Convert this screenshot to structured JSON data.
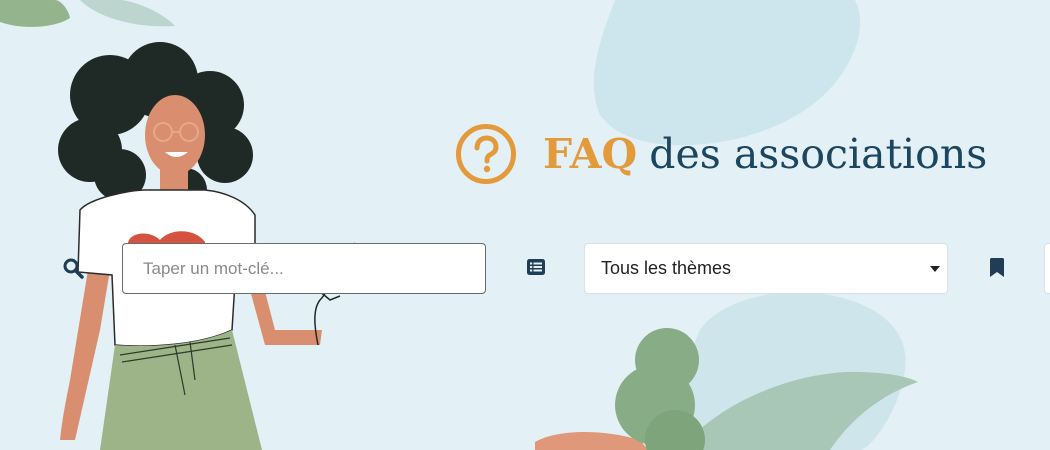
{
  "header": {
    "title_highlight": "FAQ",
    "title_rest": "des associations",
    "help_icon": "question-circle-icon"
  },
  "filters": {
    "search_icon": "search-icon",
    "search_placeholder": "Taper un mot-clé...",
    "search_value": "",
    "list_icon": "list-icon",
    "theme_selected": "Tous les thèmes",
    "bookmark_icon": "bookmark-icon"
  },
  "colors": {
    "background": "#e3f1f6",
    "accent_orange": "#e39a3b",
    "title_dark": "#1c4560",
    "icon_dark": "#1f3d55"
  }
}
